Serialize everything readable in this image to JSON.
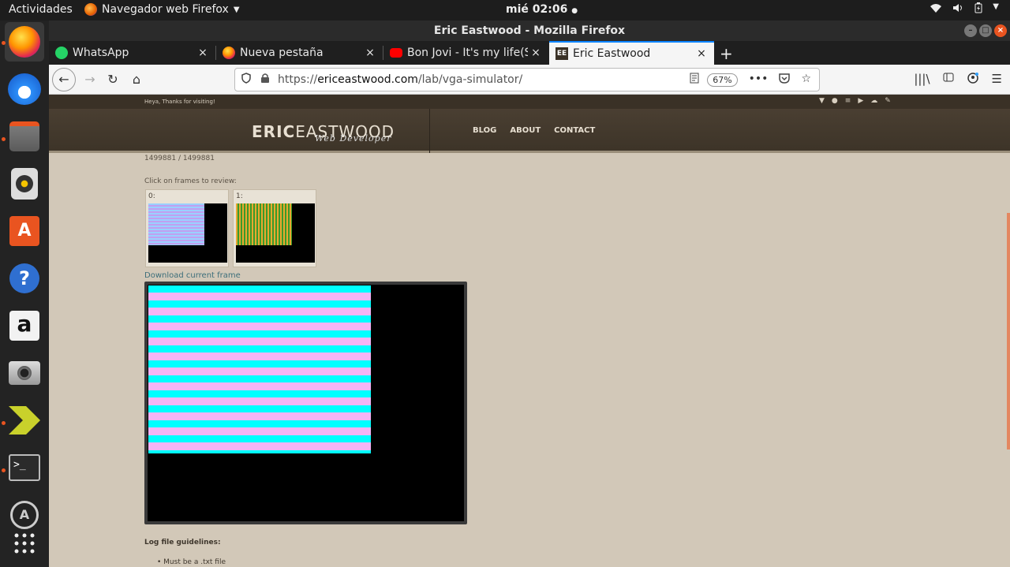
{
  "topbar": {
    "activities": "Actividades",
    "app_menu": "Navegador web Firefox",
    "clock": "mié 02:06"
  },
  "dock": {
    "items": [
      "firefox-icon",
      "thunderbird-icon",
      "files-icon",
      "rhythmbox-icon",
      "software-icon",
      "help-icon",
      "amazon-icon",
      "camera-icon",
      "terminal-alt-icon",
      "terminal-icon",
      "updater-icon",
      "app-grid-icon"
    ]
  },
  "window": {
    "title": "Eric Eastwood - Mozilla Firefox"
  },
  "tabs": [
    {
      "title": "WhatsApp",
      "close": "×"
    },
    {
      "title": "Nueva pestaña",
      "close": "×"
    },
    {
      "title": "Bon Jovi - It's my life(Sub",
      "close": "×"
    },
    {
      "title": "Eric Eastwood",
      "close": "×"
    }
  ],
  "newtab": "+",
  "navbar": {
    "url_prefix": "https://",
    "url_domain": "ericeastwood.com",
    "url_path": "/lab/vga-simulator/",
    "zoom": "67%"
  },
  "site": {
    "topstrip_text": "Heya, Thanks for visiting!",
    "logo_bold": "ERIC",
    "logo_light": "EASTWOOD",
    "logo_sub": "Web Developer",
    "menu": [
      "BLOG",
      "ABOUT",
      "CONTACT"
    ]
  },
  "content": {
    "counter": "1499881 / 1499881",
    "frames_title": "Click on frames to review:",
    "frames": [
      {
        "label": "0:"
      },
      {
        "label": "1:"
      }
    ],
    "download": "Download current frame",
    "guidelines": "Log file guidelines:",
    "bullet": "Must be a .txt file"
  },
  "colors": {
    "stripe_cyan": "#00ffff",
    "stripe_pink": "#f5b4f5",
    "thumb1_a": "#e8a830",
    "thumb1_b": "#3a9a2a",
    "accent": "#e95420"
  }
}
